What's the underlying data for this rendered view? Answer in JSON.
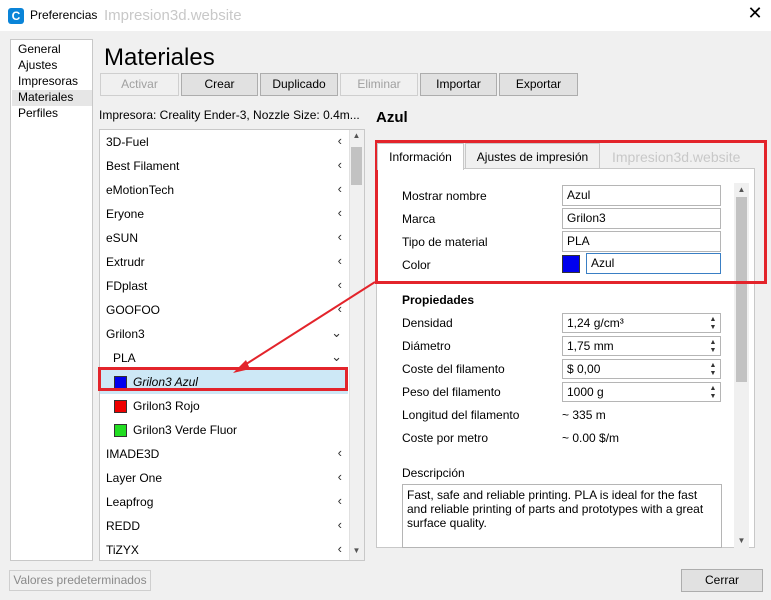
{
  "window": {
    "app_icon": "C",
    "title": "Preferencias",
    "watermark": "Impresion3d.website",
    "close_glyph": "✕"
  },
  "nav": {
    "items": [
      "General",
      "Ajustes",
      "Impresoras",
      "Materiales",
      "Perfiles"
    ],
    "selected": "Materiales"
  },
  "page": {
    "heading": "Materiales",
    "printer_info": "Impresora: Creality Ender-3, Nozzle Size: 0.4m..."
  },
  "toolbar": {
    "activar": "Activar",
    "crear": "Crear",
    "duplicado": "Duplicado",
    "eliminar": "Eliminar",
    "importar": "Importar",
    "exportar": "Exportar"
  },
  "materials": {
    "brands": {
      "b0": "3D-Fuel",
      "b1": "Best Filament",
      "b2": "eMotionTech",
      "b3": "Eryone",
      "b4": "eSUN",
      "b5": "Extrudr",
      "b6": "FDplast",
      "b7": "GOOFOO",
      "b8": "Grilon3",
      "b9": "IMADE3D",
      "b10": "Layer One",
      "b11": "Leapfrog",
      "b12": "REDD",
      "b13": "TiZYX"
    },
    "type": "PLA",
    "items": {
      "i0": {
        "label": "Grilon3 Azul",
        "color": "#0000ee"
      },
      "i1": {
        "label": "Grilon3 Rojo",
        "color": "#ee0000"
      },
      "i2": {
        "label": "Grilon3 Verde Fluor",
        "color": "#22dd22"
      }
    },
    "chevron_collapsed": "‹",
    "chevron_expanded": "⌄",
    "scroll_up": "▲",
    "scroll_down": "▼"
  },
  "detail": {
    "title": "Azul",
    "tabs": {
      "info": "Información",
      "print": "Ajustes de impresión"
    },
    "watermark": "Impresion3d.website",
    "labels": {
      "display_name": "Mostrar nombre",
      "brand": "Marca",
      "material_type": "Tipo de material",
      "color": "Color"
    },
    "values": {
      "display_name": "Azul",
      "brand": "Grilon3",
      "material_type": "PLA",
      "color_name": "Azul",
      "color_hex": "#0000ee"
    },
    "properties_heading": "Propiedades",
    "props": {
      "density_label": "Densidad",
      "density": "1,24 g/cm³",
      "diameter_label": "Diámetro",
      "diameter": "1,75 mm",
      "cost_label": "Coste del filamento",
      "cost": "$ 0,00",
      "weight_label": "Peso del filamento",
      "weight": "1000 g",
      "length_label": "Longitud del filamento",
      "length": "~ 335 m",
      "cpm_label": "Coste por metro",
      "cpm": "~ 0.00 $/m"
    },
    "description_label": "Descripción",
    "description": "Fast, safe and reliable printing. PLA is ideal for the fast and reliable printing of parts and prototypes with a great surface quality."
  },
  "footer": {
    "reset": "Valores predeterminados",
    "close": "Cerrar"
  },
  "annotation_color": "#e3242b"
}
